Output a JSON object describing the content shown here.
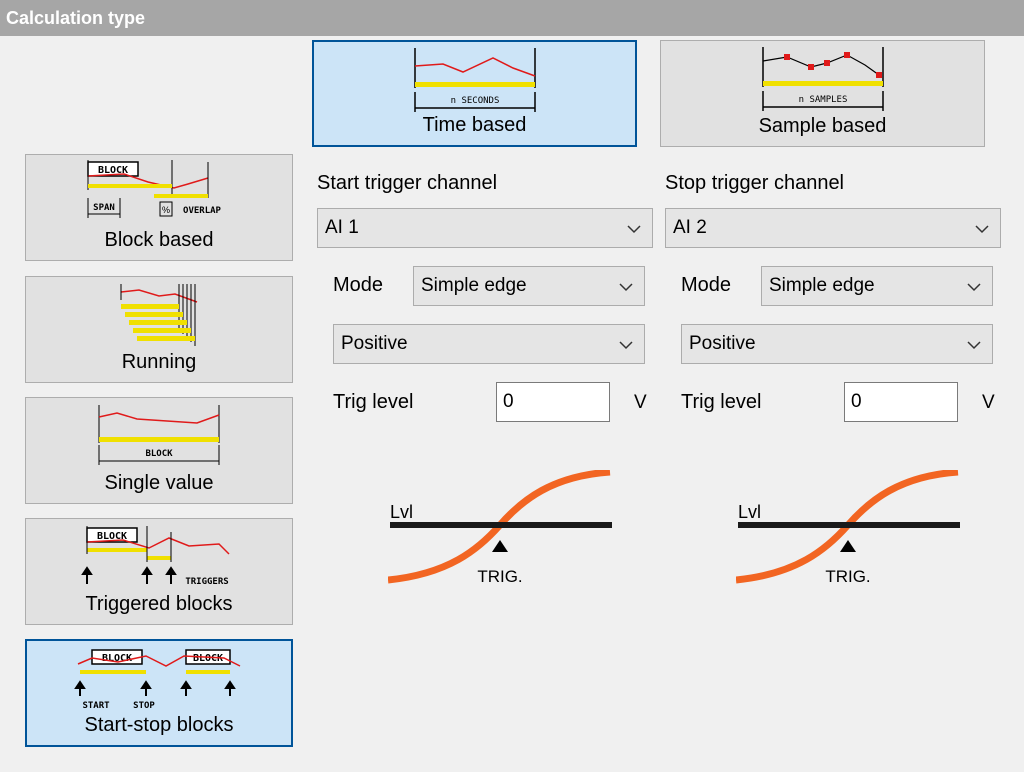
{
  "header": {
    "title": "Calculation type"
  },
  "calc_types": [
    {
      "label": "Block based",
      "selected": false
    },
    {
      "label": "Running",
      "selected": false
    },
    {
      "label": "Single value",
      "selected": false
    },
    {
      "label": "Triggered blocks",
      "selected": false
    },
    {
      "label": "Start-stop blocks",
      "selected": true
    }
  ],
  "basis": [
    {
      "label": "Time based",
      "selected": true,
      "icon_text": "n SECONDS"
    },
    {
      "label": "Sample based",
      "selected": false,
      "icon_text": "n SAMPLES"
    }
  ],
  "icon_text": {
    "block": "BLOCK",
    "span": "SPAN",
    "pct": "%",
    "overlap": "OVERLAP",
    "triggers": "TRIGGERS",
    "start": "START",
    "stop": "STOP"
  },
  "start": {
    "heading": "Start trigger channel",
    "channel": "AI 1",
    "mode_label": "Mode",
    "mode": "Simple edge",
    "edge": "Positive",
    "level_label": "Trig level",
    "level": "0",
    "unit": "V",
    "graph_lvl": "Lvl",
    "graph_trig": "TRIG."
  },
  "stop": {
    "heading": "Stop trigger channel",
    "channel": "AI 2",
    "mode_label": "Mode",
    "mode": "Simple edge",
    "edge": "Positive",
    "level_label": "Trig level",
    "level": "0",
    "unit": "V",
    "graph_lvl": "Lvl",
    "graph_trig": "TRIG."
  },
  "colors": {
    "title_bg": "#a6a6a6",
    "selected_bg": "#cce4f7",
    "selected_border": "#005499",
    "signal_red": "#e01a1a",
    "block_yellow": "#f0e000",
    "curve_orange": "#f26522"
  },
  "icons": [
    "chevron-down-icon",
    "block-based-icon",
    "running-icon",
    "single-value-icon",
    "triggered-blocks-icon",
    "start-stop-blocks-icon",
    "time-based-icon",
    "sample-based-icon",
    "trigger-curve-graph"
  ]
}
